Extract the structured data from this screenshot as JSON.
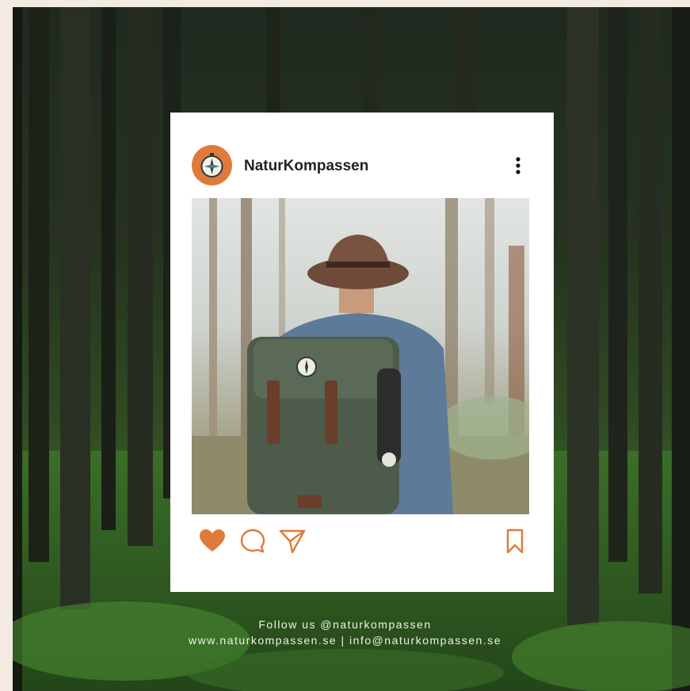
{
  "post": {
    "username": "NaturKompassen",
    "avatar_icon": "compass-icon",
    "menu_icon": "more-vertical-icon",
    "image_description_icon": "photo",
    "actions": {
      "like_icon": "heart-icon",
      "comment_icon": "comment-icon",
      "share_icon": "send-icon",
      "save_icon": "bookmark-icon"
    }
  },
  "footer": {
    "follow_text": "Follow us @naturkompassen",
    "contact_text": "www.naturkompassen.se | info@naturkompassen.se"
  },
  "colors": {
    "accent": "#e07a3a",
    "page_bg": "#f3ebe2",
    "card_bg": "#ffffff"
  }
}
